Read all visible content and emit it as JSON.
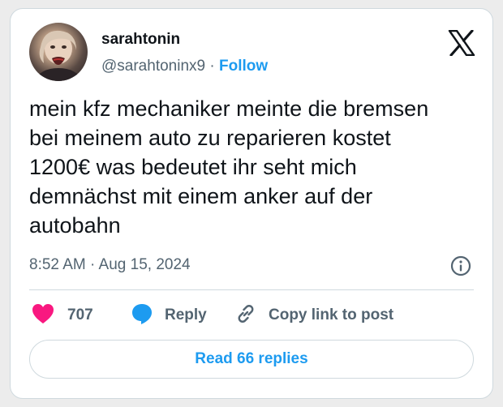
{
  "author": {
    "display_name": "sarahtonin",
    "handle": "@sarahtoninx9",
    "separator": " · ",
    "follow_label": "Follow"
  },
  "tweet": {
    "text": "mein kfz mechaniker meinte die bremsen\nbei meinem auto zu reparieren kostet\n1200€ was bedeutet ihr seht mich\ndemnächst mit einem anker auf der\nautobahn",
    "timestamp": "8:52 AM · Aug 15, 2024"
  },
  "actions": {
    "like_count": "707",
    "reply_label": "Reply",
    "copy_link_label": "Copy link to post"
  },
  "read_replies_label": "Read 66 replies",
  "icons": {
    "brand": "x-logo-icon",
    "info": "info-icon",
    "like": "heart-icon",
    "reply": "speech-bubble-icon",
    "copy": "link-icon"
  },
  "colors": {
    "accent": "#1d9bf0",
    "like": "#f91880",
    "text_primary": "#0f1419",
    "text_secondary": "#536471",
    "border": "#cfd9de"
  }
}
